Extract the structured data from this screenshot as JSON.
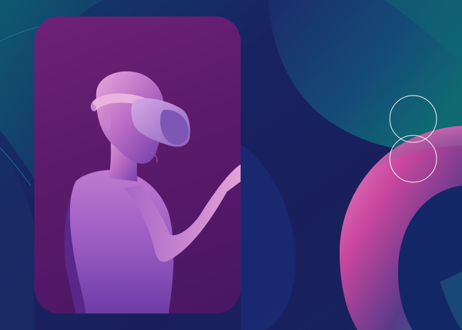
{
  "scene": {
    "background_icon": "abstract-waves-background",
    "photo_icon": "vr-headset-figure-illustration",
    "ring_icon": "gradient-ring-icon",
    "circles_icon": "stacked-outline-circles-icon"
  },
  "colors": {
    "background_dark": "#16205a",
    "background_teal": "#0f5c72",
    "card_magenta": "#6d2275",
    "figure_pink": "#e5a4dc",
    "ring_pink": "#d14a9c",
    "ring_teal": "#2a8894",
    "circle_stroke": "#ffffff"
  }
}
